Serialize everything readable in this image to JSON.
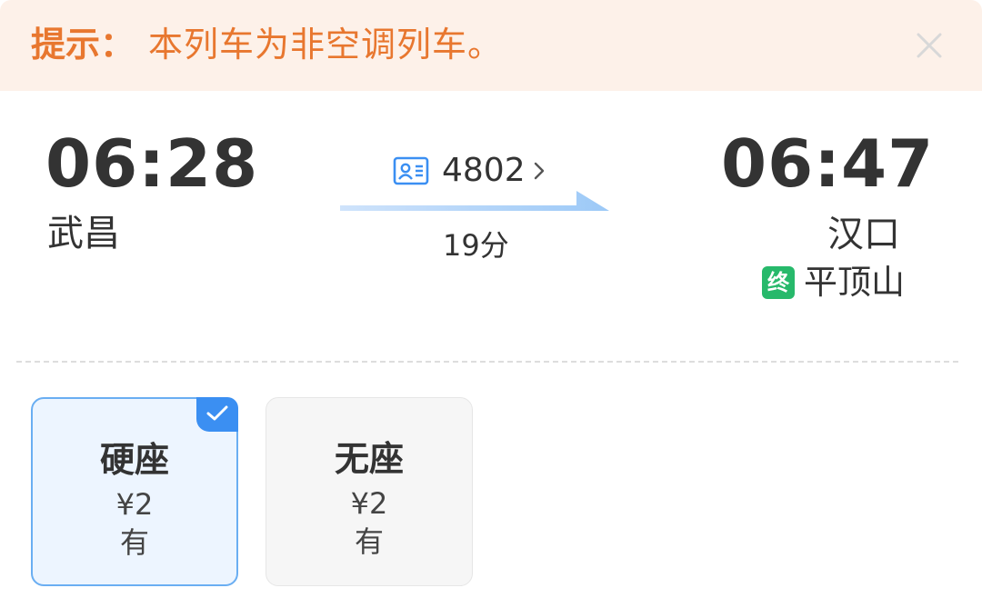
{
  "notice": {
    "label": "提示：",
    "text": "本列车为非空调列车。",
    "close_icon": "close-icon"
  },
  "train": {
    "departure_time": "06:28",
    "departure_station": "武昌",
    "arrival_time": "06:47",
    "arrival_station": "汉口",
    "terminal_badge": "终",
    "terminal_station": "平顶山",
    "number": "4802",
    "duration": "19分",
    "icons": {
      "id": "id-card-icon",
      "chevron": "chevron-right-icon",
      "arrow": "route-arrow-icon"
    }
  },
  "seats": [
    {
      "name": "硬座",
      "price": "¥2",
      "availability": "有",
      "selected": true
    },
    {
      "name": "无座",
      "price": "¥2",
      "availability": "有",
      "selected": false
    }
  ],
  "colors": {
    "notice_bg": "#fdf1e9",
    "notice_text": "#e8772f",
    "accent": "#3b8ff2",
    "terminal_badge": "#27b96b",
    "selected_card_bg": "#edf5ff",
    "selected_card_border": "#6aaef2"
  }
}
